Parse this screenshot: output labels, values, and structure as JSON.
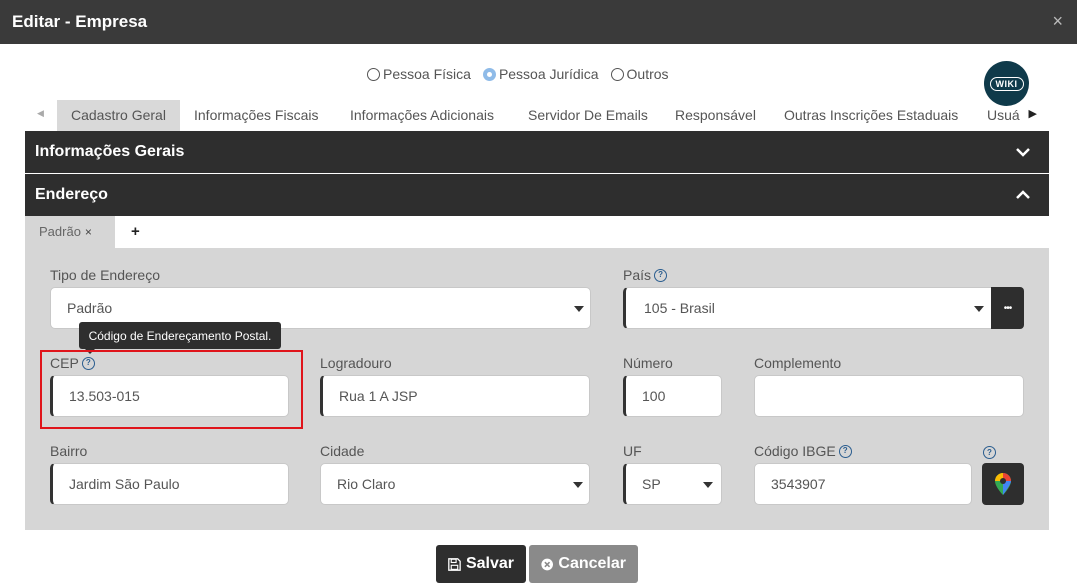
{
  "window": {
    "title": "Editar - Empresa",
    "close_symbol": "×"
  },
  "person_types": [
    {
      "label": "Pessoa Física",
      "checked": false
    },
    {
      "label": "Pessoa Jurídica",
      "checked": true
    },
    {
      "label": "Outros",
      "checked": false
    }
  ],
  "wiki": {
    "label": "WIKI"
  },
  "tabs": [
    "Cadastro Geral",
    "Informações Fiscais",
    "Informações Adicionais",
    "Servidor De Emails",
    "Responsável",
    "Outras Inscrições Estaduais",
    "Usuá"
  ],
  "sections": {
    "general": "Informações Gerais",
    "address": "Endereço"
  },
  "address_tabs": {
    "active": "Padrão",
    "close": "×",
    "add": "+"
  },
  "form": {
    "tipo_endereco": {
      "label": "Tipo de Endereço",
      "value": "Padrão"
    },
    "pais": {
      "label": "País",
      "value": "105 - Brasil",
      "more": "•••"
    },
    "cep": {
      "label": "CEP",
      "value": "13.503-015",
      "tooltip": "Código de Endereçamento Postal."
    },
    "logradouro": {
      "label": "Logradouro",
      "value": "Rua 1 A JSP"
    },
    "numero": {
      "label": "Número",
      "value": "100"
    },
    "complemento": {
      "label": "Complemento",
      "value": ""
    },
    "bairro": {
      "label": "Bairro",
      "value": "Jardim São Paulo"
    },
    "cidade": {
      "label": "Cidade",
      "value": "Rio Claro"
    },
    "uf": {
      "label": "UF",
      "value": "SP"
    },
    "codigo_ibge": {
      "label": "Código IBGE",
      "value": "3543907"
    }
  },
  "help_symbol": "?",
  "buttons": {
    "save": "Salvar",
    "cancel": "Cancelar"
  },
  "colors": {
    "header": "#3a3a3a",
    "panel": "#d6d6d6",
    "highlight": "#e0141b",
    "radio_checked": "#8fbbe8"
  }
}
